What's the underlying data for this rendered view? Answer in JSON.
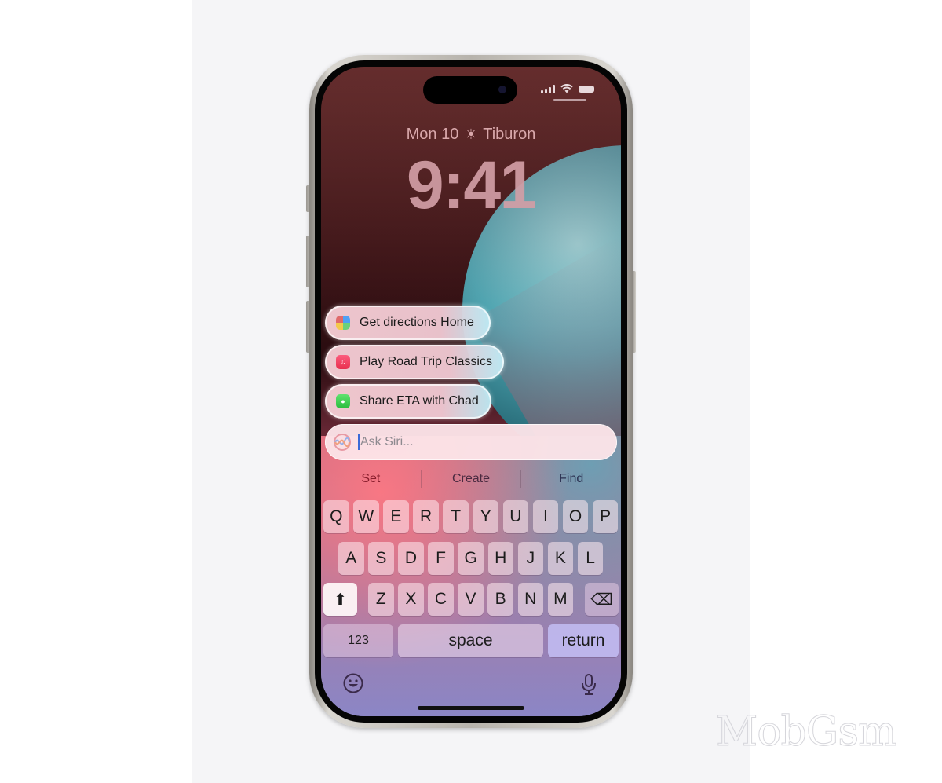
{
  "status_bar": {
    "signal_icon": "cellular-signal-icon",
    "wifi_icon": "wifi-icon",
    "battery_icon": "battery-icon"
  },
  "lock_screen": {
    "date": "Mon 10",
    "weather_icon": "sun-icon",
    "weather_glyph": "☀",
    "location": "Tiburon",
    "time": "9:41"
  },
  "siri_suggestions": [
    {
      "label": "Get directions Home",
      "icon": "maps-icon",
      "icon_glyph": ""
    },
    {
      "label": "Play Road Trip Classics",
      "icon": "music-icon",
      "icon_glyph": "♫"
    },
    {
      "label": "Share ETA with Chad",
      "icon": "messages-icon",
      "icon_glyph": "●"
    }
  ],
  "siri_input": {
    "placeholder": "Ask Siri...",
    "value": "",
    "icon": "apple-intelligence-siri-icon"
  },
  "predictive_bar": [
    {
      "label": "Set",
      "color": "#8a1f2e"
    },
    {
      "label": "Create",
      "color": "#4a2a40"
    },
    {
      "label": "Find",
      "color": "#2a3050"
    }
  ],
  "keyboard": {
    "row1": [
      "Q",
      "W",
      "E",
      "R",
      "T",
      "Y",
      "U",
      "I",
      "O",
      "P"
    ],
    "row2": [
      "A",
      "S",
      "D",
      "F",
      "G",
      "H",
      "J",
      "K",
      "L"
    ],
    "row3": [
      "Z",
      "X",
      "C",
      "V",
      "B",
      "N",
      "M"
    ],
    "shift_glyph": "⬆",
    "delete_glyph": "⌫",
    "numbers_label": "123",
    "space_label": "space",
    "return_label": "return"
  },
  "bottom_bar": {
    "emoji_icon": "emoji-icon",
    "mic_icon": "microphone-icon"
  },
  "watermark": "MobGsm"
}
